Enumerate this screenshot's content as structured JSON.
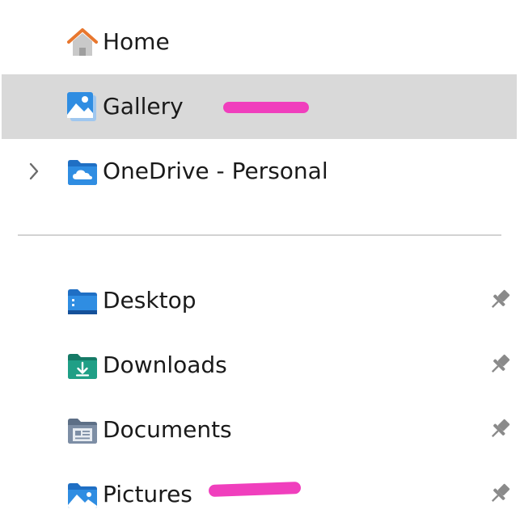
{
  "nav": {
    "quick_items": [
      {
        "label": "Home",
        "icon": "home-icon",
        "selected": false
      },
      {
        "label": "Gallery",
        "icon": "gallery-icon",
        "selected": true
      },
      {
        "label": "OneDrive - Personal",
        "icon": "onedrive-folder-icon",
        "expandable": true
      }
    ],
    "pinned_items": [
      {
        "label": "Desktop",
        "icon": "desktop-folder-icon",
        "pinned": true
      },
      {
        "label": "Downloads",
        "icon": "downloads-folder-icon",
        "pinned": true
      },
      {
        "label": "Documents",
        "icon": "documents-folder-icon",
        "pinned": true
      },
      {
        "label": "Pictures",
        "icon": "pictures-folder-icon",
        "pinned": true
      }
    ]
  },
  "colors": {
    "selected_background": "#d9d9d9",
    "annotation_mark": "#f03fbd",
    "folder_blue": "#2f8de2",
    "downloads_teal": "#1f9f86",
    "home_orange": "#e8772e",
    "pin_gray": "#8a8a8a"
  }
}
